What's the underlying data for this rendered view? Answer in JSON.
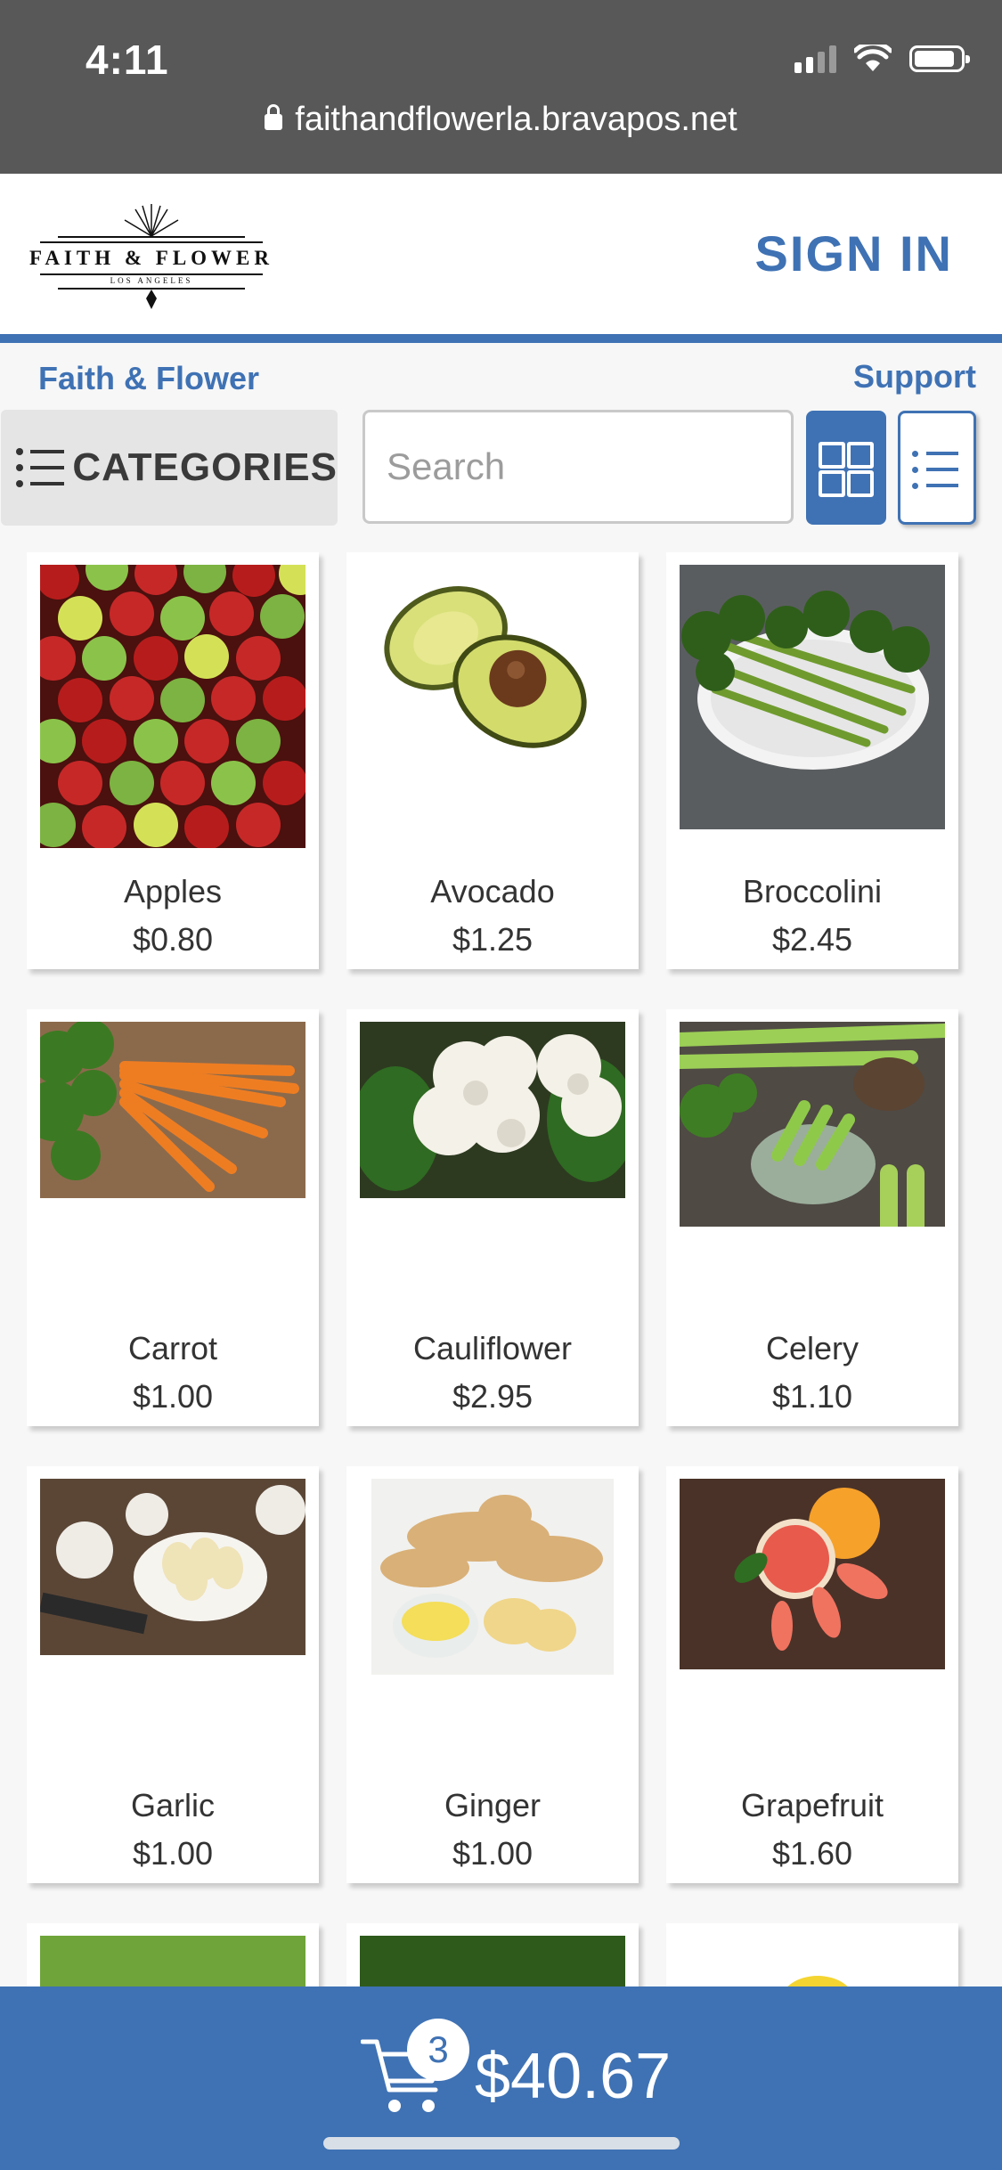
{
  "status_bar": {
    "time": "4:11",
    "url": "faithandflowerla.bravapos.net"
  },
  "header": {
    "logo": {
      "title": "FAITH & FLOWER",
      "subtitle": "LOS ANGELES"
    },
    "sign_in_label": "SIGN IN",
    "brand_color": "#3f72b4"
  },
  "breadcrumb": {
    "store_name": "Faith & Flower",
    "support_label": "Support"
  },
  "toolbar": {
    "categories_label": "CATEGORIES",
    "search_placeholder": "Search",
    "active_view": "grid"
  },
  "products": [
    {
      "name": "Apples",
      "price": "$0.80"
    },
    {
      "name": "Avocado",
      "price": "$1.25"
    },
    {
      "name": "Broccolini",
      "price": "$2.45"
    },
    {
      "name": "Carrot",
      "price": "$1.00"
    },
    {
      "name": "Cauliflower",
      "price": "$2.95"
    },
    {
      "name": "Celery",
      "price": "$1.10"
    },
    {
      "name": "Garlic",
      "price": "$1.00"
    },
    {
      "name": "Ginger",
      "price": "$1.00"
    },
    {
      "name": "Grapefruit",
      "price": "$1.60"
    }
  ],
  "cart": {
    "count": "3",
    "total": "$40.67"
  }
}
